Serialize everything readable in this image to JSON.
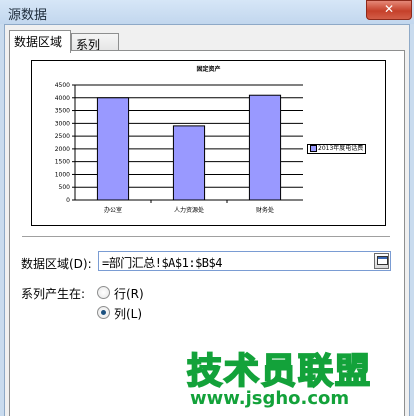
{
  "window": {
    "title": "源数据"
  },
  "tabs": [
    {
      "label": "数据区域"
    },
    {
      "label": "系列"
    }
  ],
  "chart_data": {
    "type": "bar",
    "title": "固定资产",
    "categories": [
      "办公室",
      "人力资源处",
      "财务处"
    ],
    "series": [
      {
        "name": "2013年度电话费",
        "values": [
          4000,
          2900,
          4100
        ]
      }
    ],
    "ylim": [
      0,
      4500
    ],
    "yticks": [
      0,
      500,
      1000,
      1500,
      2000,
      2500,
      3000,
      3500,
      4000,
      4500
    ],
    "legend": "right",
    "grid": true,
    "colors": {
      "bar": "#9999ff"
    }
  },
  "range": {
    "label": "数据区域(D):",
    "value": "=部门汇总!$A$1:$B$4"
  },
  "series_in": {
    "label": "系列产生在:",
    "options": [
      {
        "label": "行(R)",
        "selected": false
      },
      {
        "label": "列(L)",
        "selected": true
      }
    ]
  },
  "watermark": {
    "text": "技术员联盟",
    "url": "www.jsgho.com"
  },
  "icons": {
    "close": "close-icon",
    "collapse": "collapse-dialog-icon"
  }
}
